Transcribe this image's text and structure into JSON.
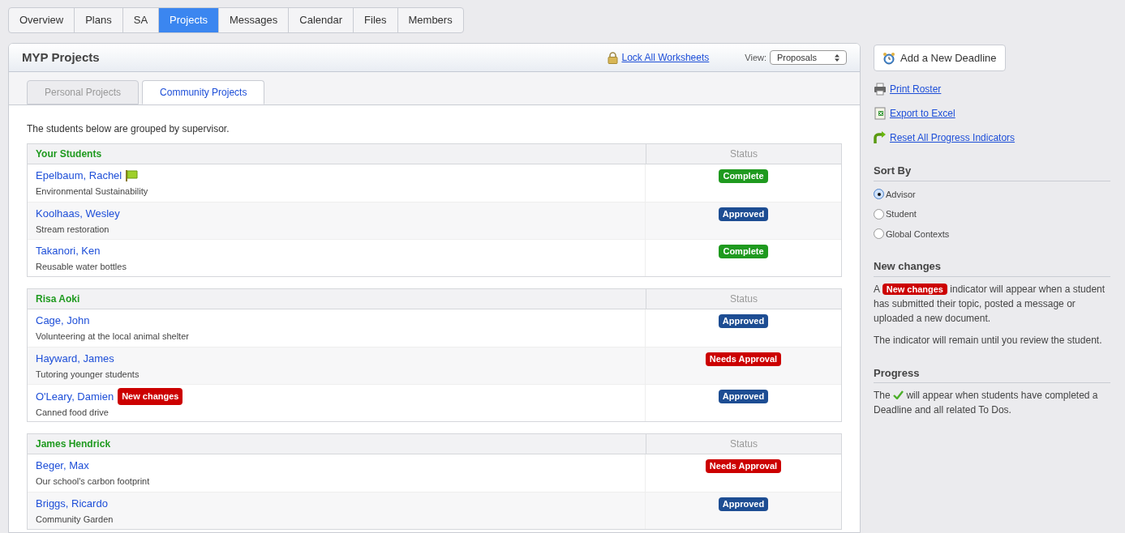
{
  "nav_tabs": [
    {
      "label": "Overview",
      "selected": false
    },
    {
      "label": "Plans",
      "selected": false
    },
    {
      "label": "SA",
      "selected": false
    },
    {
      "label": "Projects",
      "selected": true
    },
    {
      "label": "Messages",
      "selected": false
    },
    {
      "label": "Calendar",
      "selected": false
    },
    {
      "label": "Files",
      "selected": false
    },
    {
      "label": "Members",
      "selected": false
    }
  ],
  "panel": {
    "title": "MYP Projects",
    "lock_link": "Lock All Worksheets",
    "view_label": "View:",
    "view_value": "Proposals",
    "tabs": [
      {
        "label": "Personal Projects",
        "selected": false
      },
      {
        "label": "Community Projects",
        "selected": true
      }
    ],
    "intro": "The students below are grouped by supervisor.",
    "groups": [
      {
        "supervisor": "Your Students",
        "status_heading": "Status",
        "students": [
          {
            "name": "Epelbaum, Rachel",
            "project": "Environmental Sustainability",
            "flag": true,
            "status": "Complete",
            "kind": "complete"
          },
          {
            "name": "Koolhaas, Wesley",
            "project": "Stream restoration",
            "flag": false,
            "status": "Approved",
            "kind": "approved"
          },
          {
            "name": "Takanori, Ken",
            "project": "Reusable water bottles",
            "flag": false,
            "status": "Complete",
            "kind": "complete"
          }
        ]
      },
      {
        "supervisor": "Risa Aoki",
        "status_heading": "Status",
        "students": [
          {
            "name": "Cage, John",
            "project": "Volunteering at the local animal shelter",
            "flag": false,
            "status": "Approved",
            "kind": "approved"
          },
          {
            "name": "Hayward, James",
            "project": "Tutoring younger students",
            "flag": false,
            "status": "Needs Approval",
            "kind": "needs_approval"
          },
          {
            "name": "O'Leary, Damien",
            "project": "Canned food drive",
            "flag": false,
            "new_changes": "New changes",
            "status": "Approved",
            "kind": "approved"
          }
        ]
      },
      {
        "supervisor": "James Hendrick",
        "status_heading": "Status",
        "students": [
          {
            "name": "Beger, Max",
            "project": "Our school's carbon footprint",
            "flag": false,
            "status": "Needs Approval",
            "kind": "needs_approval"
          },
          {
            "name": "Briggs, Ricardo",
            "project": "Community Garden",
            "flag": false,
            "status": "Approved",
            "kind": "approved"
          }
        ]
      }
    ]
  },
  "sidebar": {
    "add_button": "Add a New Deadline",
    "links": [
      {
        "label": "Print Roster",
        "kind": "print"
      },
      {
        "label": "Export to Excel",
        "kind": "excel"
      },
      {
        "label": "Reset All Progress Indicators",
        "kind": "reset"
      }
    ],
    "sort_heading": "Sort By",
    "sort_options": [
      {
        "label": "Advisor",
        "selected": true
      },
      {
        "label": "Student",
        "selected": false
      },
      {
        "label": "Global Contexts",
        "selected": false
      }
    ],
    "new_changes_heading": "New changes",
    "new_changes_text": {
      "before": "A",
      "badge": "New changes",
      "after": "indicator will appear when a student has submitted their topic, posted a message or uploaded a new document."
    },
    "new_changes_note": "The indicator will remain until you review the student.",
    "progress_heading": "Progress",
    "progress_text": {
      "before": "The",
      "after": "will appear when students have completed a Deadline and all related To Dos."
    }
  }
}
